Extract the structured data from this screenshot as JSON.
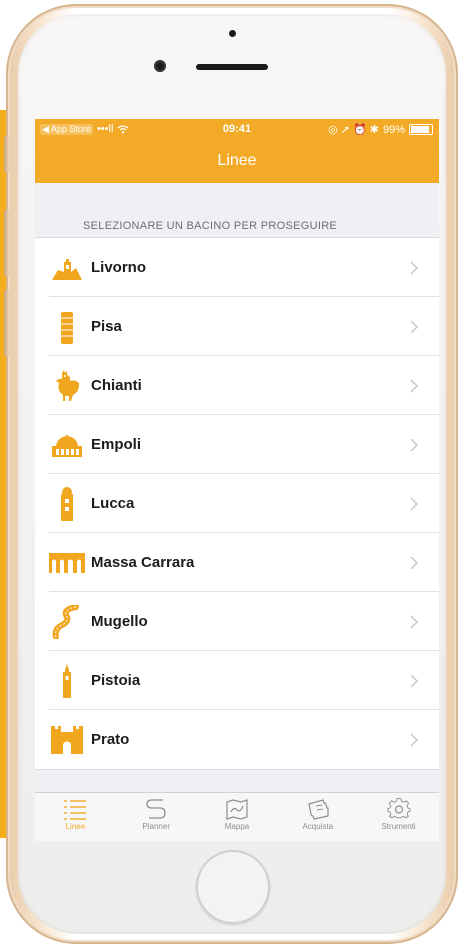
{
  "status_bar": {
    "back_label": "◀ App Store",
    "signal": "•••ll",
    "wifi": "wifi-icon",
    "time": "09:41",
    "right_icons": "◎ ➚ ⏰ ✱",
    "battery_text": "99%",
    "battery_level": 0.99
  },
  "nav": {
    "title": "Linee"
  },
  "section": {
    "header": "SELEZIONARE UN BACINO PER PROSEGUIRE"
  },
  "colors": {
    "accent": "#f3ab27",
    "icon": "#f0a71f"
  },
  "list_items": [
    {
      "label": "Livorno",
      "icon": "livorno-castle-icon"
    },
    {
      "label": "Pisa",
      "icon": "pisa-tower-icon"
    },
    {
      "label": "Chianti",
      "icon": "rooster-icon"
    },
    {
      "label": "Empoli",
      "icon": "church-dome-icon"
    },
    {
      "label": "Lucca",
      "icon": "tree-tower-icon"
    },
    {
      "label": "Massa Carrara",
      "icon": "aqueduct-icon"
    },
    {
      "label": "Mugello",
      "icon": "road-icon"
    },
    {
      "label": "Pistoia",
      "icon": "bell-tower-icon"
    },
    {
      "label": "Prato",
      "icon": "castle-icon"
    }
  ],
  "tabs": [
    {
      "label": "Linee",
      "icon": "list-icon",
      "active": true
    },
    {
      "label": "Planner",
      "icon": "route-icon",
      "active": false
    },
    {
      "label": "Mappa",
      "icon": "map-icon",
      "active": false
    },
    {
      "label": "Acquista",
      "icon": "ticket-icon",
      "active": false
    },
    {
      "label": "Strumenti",
      "icon": "gear-icon",
      "active": false
    }
  ]
}
